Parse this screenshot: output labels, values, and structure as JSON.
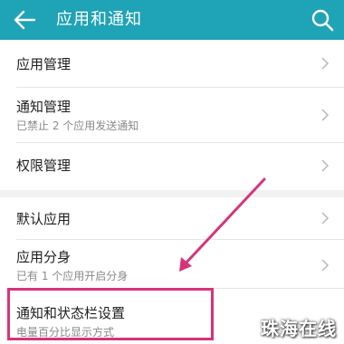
{
  "header": {
    "title": "应用和通知",
    "back_icon": "back-arrow-icon",
    "search_icon": "search-icon",
    "color": "#1fa3b6"
  },
  "group1": {
    "items": [
      {
        "label": "应用管理"
      },
      {
        "label": "通知管理",
        "sub": "已禁止 2 个应用发送通知"
      },
      {
        "label": "权限管理"
      }
    ]
  },
  "group2": {
    "items": [
      {
        "label": "默认应用"
      },
      {
        "label": "应用分身",
        "sub": "已有 1 个应用开启分身"
      },
      {
        "label": "通知和状态栏设置",
        "sub": "电量百分比显示方式"
      }
    ]
  },
  "annotation": {
    "color": "#d8337a"
  },
  "watermark": "珠海在线"
}
